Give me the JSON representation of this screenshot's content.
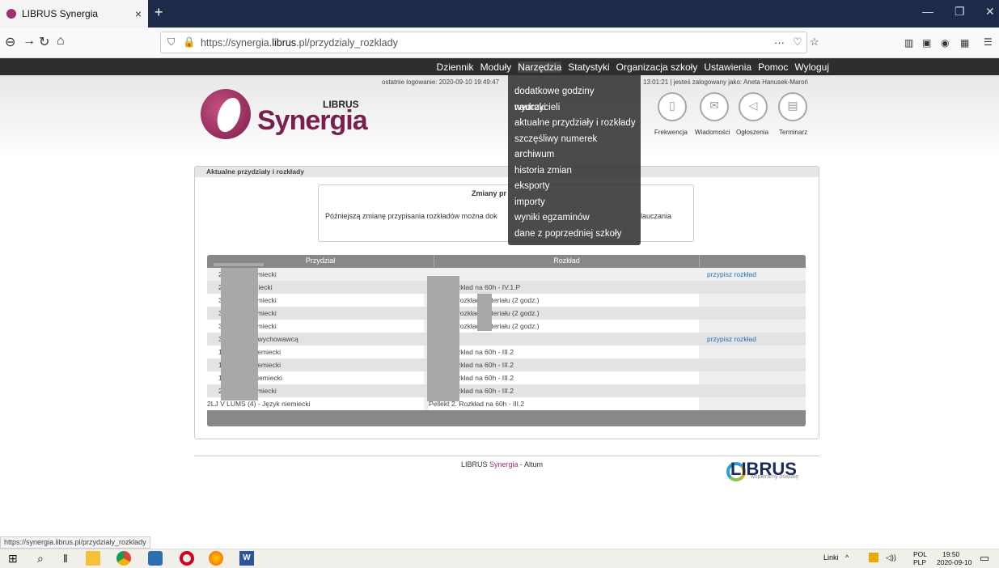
{
  "browser": {
    "tab_title": "LIBRUS Synergia",
    "tab_close": "×",
    "new_tab": "+",
    "url_host_prefix": "https://synergia.",
    "url_host_bold": "librus",
    "url_path": ".pl/przydzialy_rozklady",
    "url_more": "···",
    "status_url": "https://synergia.librus.pl/przydzialy_rozklady"
  },
  "menu": {
    "items": [
      "Dziennik",
      "Moduły",
      "Narzędzia",
      "Statystyki",
      "Organizacja szkoły",
      "Ustawienia",
      "Pomoc",
      "Wyloguj"
    ]
  },
  "header": {
    "last_login": "ostatnie logowanie: 2020-09-10 19:49:47",
    "logged_in": "13:01:21  |  jesteś zalogowany jako: Aneta Hanusek-Maroń",
    "logo_librus": "LIBRUS",
    "logo_synergia": "Synergia",
    "icons": [
      {
        "label": "Frekwencja",
        "icon": "clipboard-icon"
      },
      {
        "label": "Wiadomości",
        "icon": "envelope-icon"
      },
      {
        "label": "Ogłoszenia",
        "icon": "megaphone-icon"
      },
      {
        "label": "Terminarz",
        "icon": "calendar-icon"
      }
    ]
  },
  "dropdown": {
    "items": [
      "dodatkowe godziny nauczycieli",
      "wydruki",
      "aktualne przydziały i rozkłady",
      "szczęśliwy numerek",
      "archiwum",
      "historia zmian",
      "eksporty",
      "importy",
      "wyniki egzaminów",
      "dane z poprzedniej szkoły"
    ]
  },
  "panel": {
    "title": "Aktualne przydziały i rozkłady",
    "info_title": "Zmiany pr",
    "info_text": "Późniejszą zmianę przypisania rozkładów można dok",
    "info_text_tail": "lauczania"
  },
  "table": {
    "headers": [
      "Przydział",
      "Rozkład"
    ],
    "rows": [
      {
        "c1": "2              - Język niemiecki",
        "c2": "",
        "c3": "przypisz rozkład"
      },
      {
        "c1": "2               Język niemiecki",
        "c2": "                        t 3. Rozkład na 60h - IV.1.P",
        "c3": ""
      },
      {
        "c1": "3              - Język niemiecki",
        "c2": "                        IA;           B - rozkład materiału (2 godz.)",
        "c3": ""
      },
      {
        "c1": "3              - Język niemiecki",
        "c2": "                        IA;           B - rozkład materiału (2 godz.)",
        "c3": ""
      },
      {
        "c1": "3              - Język niemiecki",
        "c2": "                        IA;           B - rozkład materiału (2 godz.)",
        "c3": ""
      },
      {
        "c1": "3              - Zajęcia z wychowawcą",
        "c2": "",
        "c3": "przypisz rozkład"
      },
      {
        "c1": "1              ) - Język niemiecki",
        "c2": "                        t 1. Rozkład na 60h - III.2",
        "c3": ""
      },
      {
        "c1": "1              ) - Język niemiecki",
        "c2": "                        t 1. Rozkład na 60h - III.2",
        "c3": ""
      },
      {
        "c1": "1              l) - Język niemiecki",
        "c2": "                        t 1. Rozkład na 60h - III.2",
        "c3": ""
      },
      {
        "c1": "2              - Język niemiecki",
        "c2": "                        t 2. Rozkład na 60h - III.2",
        "c3": ""
      },
      {
        "c1": "2LJ V LUMS (4) - Język niemiecki",
        "c2": "Pellekt 2. Rozkład na 60h - III.2",
        "c3": ""
      }
    ]
  },
  "footer": {
    "text_a": "LIBRUS ",
    "text_s": "Synergia",
    "text_b": " - Altum",
    "logo": "LIBRUS",
    "logo_sub": "wspieramy oświatę"
  },
  "taskbar": {
    "links": "Linki",
    "lang": "POL",
    "lang2": "PLP",
    "time": "19:50",
    "date": "2020-09-10"
  }
}
